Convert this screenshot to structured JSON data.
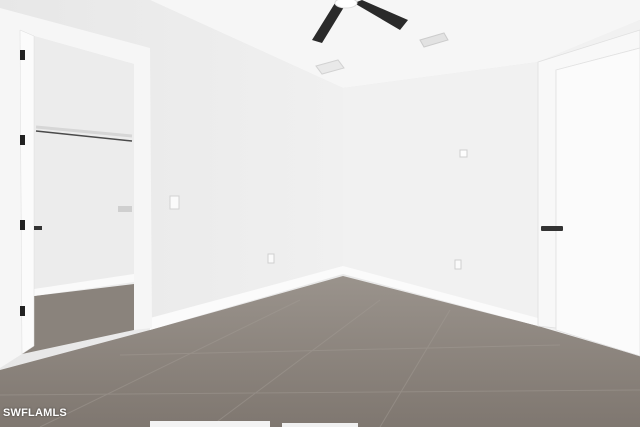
{
  "watermark": {
    "text": "SWFLAMLS"
  },
  "colors": {
    "wall_left": "#eeeeee",
    "wall_back": "#f2f2f2",
    "ceiling": "#f7f7f7",
    "floor": "#8f8780",
    "door": "#fafafa",
    "fan_blade": "#2a2a2a",
    "hardware": "#333333"
  },
  "icons": [
    "ceiling-fan-icon",
    "air-vent-icon",
    "light-switch-icon",
    "outlet-icon",
    "door-handle-icon"
  ]
}
